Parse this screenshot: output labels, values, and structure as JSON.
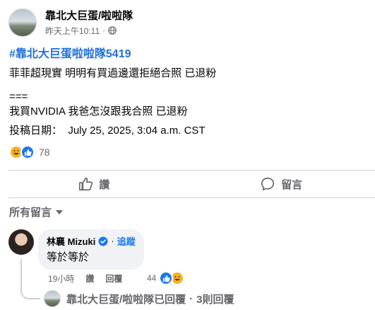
{
  "post": {
    "page_name": "靠北大巨蛋/啦啦隊",
    "timestamp": "昨天上午10:11",
    "separator": "·",
    "privacy_icon": "globe-icon",
    "hashtag": "#靠北大巨蛋啦啦隊5419",
    "line1": "菲菲超現實 明明有買過邊還拒絕合照 已退粉",
    "line2": "===",
    "line3": "我買NVIDIA 我爸怎沒跟我合照 已退粉",
    "line4": "投稿日期：  July 25, 2025, 3:04 a.m. CST",
    "reaction_count": "78"
  },
  "actions": {
    "like_label": "讚",
    "comment_label": "留言"
  },
  "comments": {
    "sort_label": "所有留言",
    "items": [
      {
        "author": "林襄 Mizuki",
        "separator": "·",
        "follow_label": "追蹤",
        "text": "等於等於",
        "time": "19小時",
        "like_label": "讚",
        "reply_label": "回覆",
        "reaction_count": "44"
      }
    ],
    "reply_summary": {
      "author_replied": "靠北大巨蛋/啦啦隊已回覆",
      "separator": "·",
      "count_label": "3則回覆"
    }
  },
  "colors": {
    "link_blue": "#216fdb",
    "facebook_blue": "#1877f2",
    "secondary_text": "#65676b"
  }
}
